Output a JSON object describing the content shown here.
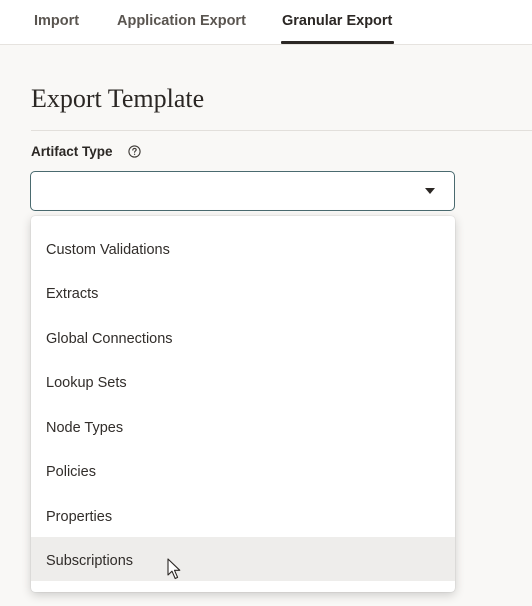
{
  "tabs": [
    {
      "label": "Import"
    },
    {
      "label": "Application Export"
    },
    {
      "label": "Granular Export",
      "active": true
    }
  ],
  "page": {
    "title": "Export Template"
  },
  "artifact_field": {
    "label": "Artifact Type",
    "help_icon": "question-circle-icon",
    "value": "",
    "caret_icon": "caret-down-icon"
  },
  "dropdown": {
    "options": [
      {
        "label": "Custom Validations"
      },
      {
        "label": "Extracts"
      },
      {
        "label": "Global Connections"
      },
      {
        "label": "Lookup Sets"
      },
      {
        "label": "Node Types"
      },
      {
        "label": "Policies"
      },
      {
        "label": "Properties"
      },
      {
        "label": "Subscriptions",
        "hovered": true
      }
    ]
  },
  "colors": {
    "background": "#f9f8f6",
    "text": "#312d2a",
    "select_border": "#4a6a6f",
    "hover": "#eeedeb",
    "active_tab_underline": "#2b2724"
  }
}
